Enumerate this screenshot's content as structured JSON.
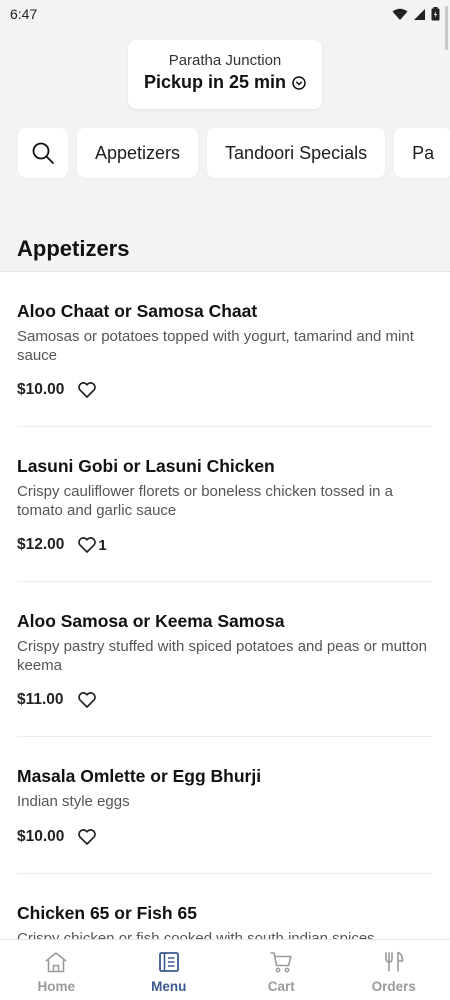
{
  "status_bar": {
    "time": "6:47"
  },
  "header": {
    "restaurant_name": "Paratha Junction",
    "pickup_text": "Pickup in 25 min"
  },
  "categories": [
    "Appetizers",
    "Tandoori Specials",
    "Pa"
  ],
  "section": {
    "title": "Appetizers"
  },
  "items": [
    {
      "name": "Aloo Chaat or Samosa Chaat",
      "description": "Samosas or potatoes topped with yogurt, tamarind and mint sauce",
      "price": "$10.00",
      "likes": ""
    },
    {
      "name": "Lasuni Gobi or Lasuni Chicken",
      "description": "Crispy cauliflower florets or boneless chicken tossed in a tomato and garlic sauce",
      "price": "$12.00",
      "likes": "1"
    },
    {
      "name": "Aloo Samosa or Keema Samosa",
      "description": "Crispy pastry stuffed with spiced potatoes and peas or mutton keema",
      "price": "$11.00",
      "likes": ""
    },
    {
      "name": "Masala Omlette or Egg Bhurji",
      "description": "Indian style eggs",
      "price": "$10.00",
      "likes": ""
    },
    {
      "name": "Chicken 65 or Fish 65",
      "description": "Crispy chicken or fish cooked with south indian spices",
      "price": "",
      "likes": ""
    }
  ],
  "nav": {
    "home": "Home",
    "menu": "Menu",
    "cart": "Cart",
    "orders": "Orders",
    "active": "Menu",
    "active_color": "#3b5a8f"
  }
}
